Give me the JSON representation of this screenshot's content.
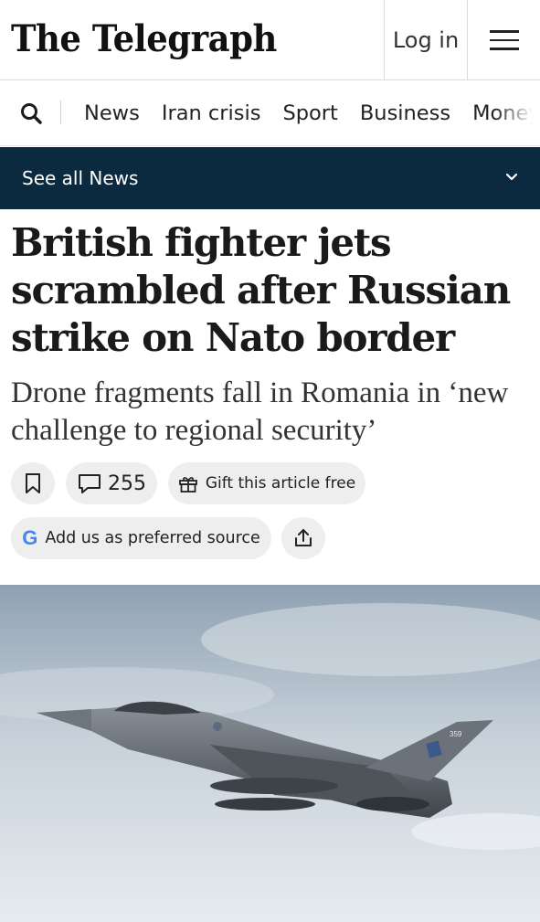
{
  "header": {
    "logo_text": "The Telegraph",
    "login_label": "Log in",
    "menu_icon": "hamburger-menu-icon"
  },
  "nav": {
    "search_icon": "search-icon",
    "items": [
      "News",
      "Iran crisis",
      "Sport",
      "Business",
      "Money"
    ]
  },
  "section_bar": {
    "label": "See all News",
    "icon": "chevron-down-icon"
  },
  "article": {
    "headline": "British fighter jets scrambled after Russian strike on Nato border",
    "standfirst": "Drone fragments fall in Romania in ‘new challenge to regional security’"
  },
  "actions": {
    "save_icon": "bookmark-icon",
    "comment_count": "255",
    "gift_label": "Gift this article free",
    "preferred_source_label": "Add us as preferred source",
    "google_letter": "G",
    "share_icon": "share-icon"
  },
  "photo": {
    "tail_number": "359"
  },
  "colors": {
    "section_bar_bg": "#0b2a3f",
    "pill_bg": "#eeeeee",
    "sky": "#c9d3dc"
  }
}
